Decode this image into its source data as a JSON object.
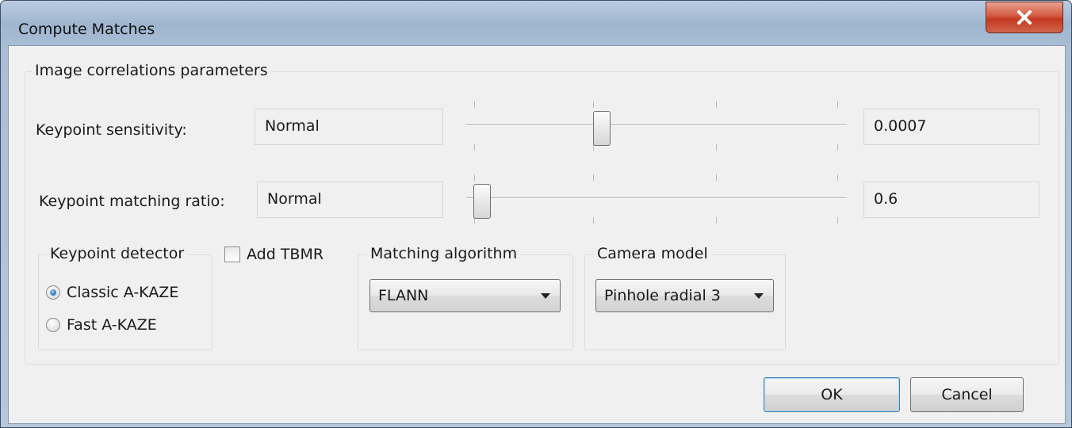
{
  "window": {
    "title": "Compute Matches",
    "close_icon": "close-x-icon"
  },
  "group_main": {
    "title": "Image correlations parameters"
  },
  "keypoint_sensitivity": {
    "label": "Keypoint sensitivity:",
    "preset": "Normal",
    "value": "0.0007",
    "slider_position": 0.33
  },
  "keypoint_matching_ratio": {
    "label": "Keypoint matching ratio:",
    "preset": "Normal",
    "value": "0.6",
    "slider_position": 0.0
  },
  "keypoint_detector": {
    "title": "Keypoint detector",
    "options": [
      {
        "label": "Classic A-KAZE",
        "checked": true
      },
      {
        "label": "Fast A-KAZE",
        "checked": false
      }
    ]
  },
  "add_tbmr": {
    "label": "Add TBMR",
    "checked": false
  },
  "matching_algorithm": {
    "title": "Matching algorithm",
    "selected": "FLANN"
  },
  "camera_model": {
    "title": "Camera model",
    "selected": "Pinhole radial 3"
  },
  "buttons": {
    "ok": "OK",
    "cancel": "Cancel"
  },
  "colors": {
    "title_bar": "#a9bed6",
    "close_button": "#c4381f",
    "dialog_background": "#f0f0f0",
    "radio_checked": "#2a7fc5"
  }
}
